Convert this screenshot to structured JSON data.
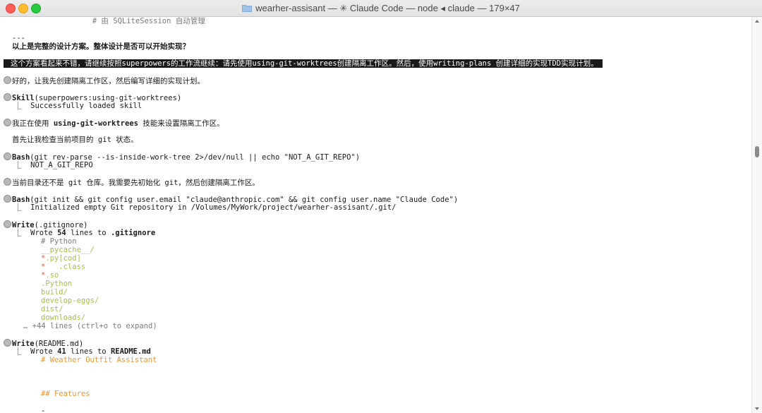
{
  "window": {
    "title": "wearher-assisant — ✳ Claude Code — node ◂ claude — 179×47"
  },
  "terminal": {
    "l01": "                  # 由 SQLiteSession 自动管理",
    "l02": "---",
    "l03": "以上是完整的设计方案。整体设计是否可以开始实现？",
    "l04": "这个方案看起来不错，请继续按照superpowers的工作流继续：请先使用using-git-worktrees创建隔离工作区。然后，使用writing-plans 创建详细的实现TDD实现计划。",
    "l05": "好的，让我先创建隔离工作区，然后编写详细的实现计划。",
    "l06_tool": "Skill",
    "l06_args": "(superpowers:using-git-worktrees)",
    "l07": "⎿  Successfully loaded skill",
    "l08_pre": "我正在使用 ",
    "l08_bold": "using-git-worktrees",
    "l08_post": " 技能来设置隔离工作区。",
    "l09": "首先让我检查当前项目的 git 状态。",
    "l10_tool": "Bash",
    "l10_args": "(git rev-parse --is-inside-work-tree 2>/dev/null || echo \"NOT_A_GIT_REPO\")",
    "l11": "⎿  NOT_A_GIT_REPO",
    "l12": "当前目录还不是 git 仓库。我需要先初始化 git，然后创建隔离工作区。",
    "l13_tool": "Bash",
    "l13_args": "(git init && git config user.email \"claude@anthropic.com\" && git config user.name \"Claude Code\")",
    "l14": "⎿  Initialized empty Git repository in /Volumes/MyWork/project/wearher-assisant/.git/",
    "l15_tool": "Write",
    "l15_args": "(.gitignore)",
    "l16_pre": "⎿  Wrote ",
    "l16_n": "54",
    "l16_mid": " lines to ",
    "l16_file": ".gitignore",
    "gitignore": {
      "g1": "# Python",
      "g2": "__pycache__/",
      "g3a": "*",
      "g3b": ".py[cod]",
      "g4a": "*",
      "g4b": "   .class",
      "g5a": "*",
      "g5b": ".so",
      "g6": ".Python",
      "g7": "build/",
      "g8": "develop-eggs/",
      "g9": "dist/",
      "g10": "downloads/"
    },
    "l17": "… +44 lines (ctrl+o to expand)",
    "l18_tool": "Write",
    "l18_args": "(README.md)",
    "l19_pre": "⎿  Wrote ",
    "l19_n": "41",
    "l19_mid": " lines to ",
    "l19_file": "README.md",
    "l20": "# Weather Outfit Assistant",
    "l21": "## Features",
    "l22": "-"
  },
  "colors": {
    "comment": "#7a7a7a",
    "green": "#a3c14d",
    "red": "#e0584a",
    "orange": "#e8973a"
  }
}
